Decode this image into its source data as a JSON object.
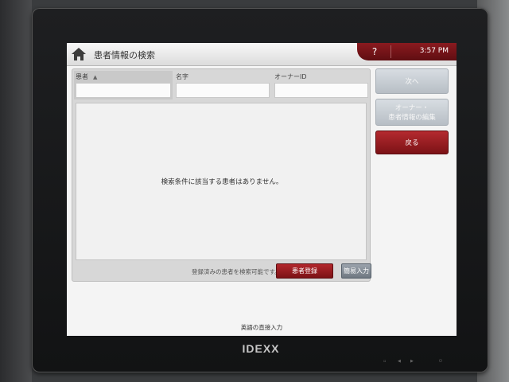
{
  "header": {
    "title": "患者情報の検索",
    "help_label": "?",
    "time": "3:57 PM"
  },
  "search": {
    "columns": [
      {
        "label": "患者",
        "sort_icon": "▲"
      },
      {
        "label": "名字"
      },
      {
        "label": "オーナーID"
      }
    ],
    "empty_message": "検索条件に該当する患者はありません。",
    "hint": "登録済みの患者を検索可能です。",
    "register_label": "患者登録",
    "quick_entry_label": "簡易入力"
  },
  "sidebar": {
    "next_label": "次へ",
    "edit_label_line1": "オーナー・",
    "edit_label_line2": "患者情報の編集",
    "back_label": "戻る"
  },
  "footer": {
    "text": "英語の直接入力"
  },
  "device": {
    "brand": "IDEXX"
  },
  "colors": {
    "accent": "#8a1a1f",
    "disabled_button": "#c7cdd3"
  }
}
